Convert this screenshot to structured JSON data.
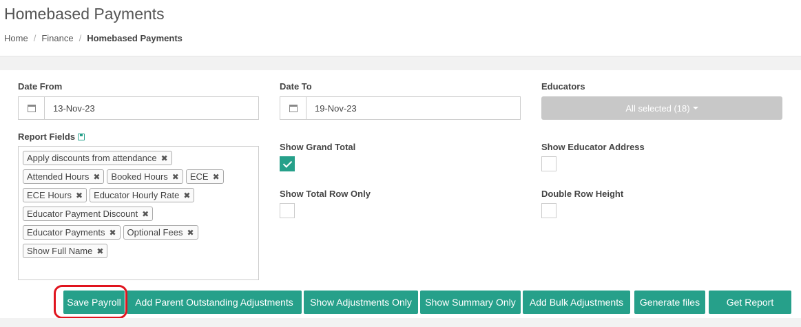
{
  "page": {
    "title": "Homebased Payments",
    "breadcrumb": [
      "Home",
      "Finance",
      "Homebased Payments"
    ]
  },
  "filters": {
    "date_from": {
      "label": "Date From",
      "value": "13-Nov-23"
    },
    "date_to": {
      "label": "Date To",
      "value": "19-Nov-23"
    },
    "educators": {
      "label": "Educators",
      "value": "All selected (18)"
    }
  },
  "report_fields": {
    "label": "Report Fields",
    "tags": [
      [
        "Apply discounts from attendance"
      ],
      [
        "Attended Hours",
        "Booked Hours",
        "ECE"
      ],
      [
        "ECE Hours",
        "Educator Hourly Rate"
      ],
      [
        "Educator Payment Discount"
      ],
      [
        "Educator Payments",
        "Optional Fees"
      ],
      [
        "Show Full Name"
      ]
    ]
  },
  "options": {
    "show_grand_total": {
      "label": "Show Grand Total",
      "checked": true
    },
    "show_educator_address": {
      "label": "Show Educator Address",
      "checked": false
    },
    "show_total_row_only": {
      "label": "Show Total Row Only",
      "checked": false
    },
    "double_row_height": {
      "label": "Double Row Height",
      "checked": false
    }
  },
  "buttons": {
    "save_payroll": "Save Payroll",
    "add_parent_outstanding": "Add Parent Outstanding Adjustments",
    "show_adjustments_only": "Show Adjustments Only",
    "show_summary_only": "Show Summary Only",
    "add_bulk_adjustments": "Add Bulk Adjustments",
    "generate_files": "Generate files",
    "get_report": "Get Report"
  },
  "colors": {
    "accent": "#26a08a",
    "highlight": "#e0141e",
    "disabled_select": "#c8c8c8"
  }
}
